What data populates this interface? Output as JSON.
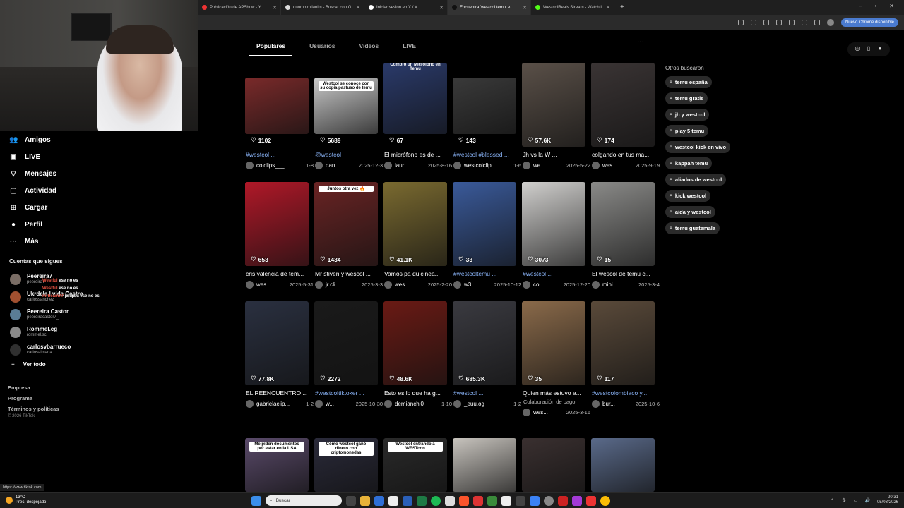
{
  "browser": {
    "tabs": [
      {
        "label": "Publicación de APShow - Y",
        "icon_color": "#e33"
      },
      {
        "label": "duomo milanim - Buscar con G",
        "icon_color": "#ddd"
      },
      {
        "label": "Iniciar sesión en X / X",
        "icon_color": "#fff"
      },
      {
        "label": "Encuentra 'westcol temu' e",
        "icon_color": "#111",
        "active": true
      },
      {
        "label": "WestcolReals Stream - Watch L",
        "icon_color": "#53fc18"
      }
    ],
    "new_tab_glyph": "+",
    "update_badge": "Nuevo Chrome disponible",
    "window_controls": [
      "–",
      "▫",
      "✕"
    ]
  },
  "sidebar": {
    "nav": [
      {
        "label": "Amigos",
        "icon": "friends-icon",
        "glyph": "👥"
      },
      {
        "label": "LIVE",
        "icon": "live-icon",
        "glyph": "▣"
      },
      {
        "label": "Mensajes",
        "icon": "messages-icon",
        "glyph": "▽"
      },
      {
        "label": "Actividad",
        "icon": "activity-icon",
        "glyph": "▢"
      },
      {
        "label": "Cargar",
        "icon": "upload-icon",
        "glyph": "⊞"
      },
      {
        "label": "Perfil",
        "icon": "profile-icon",
        "glyph": "●"
      },
      {
        "label": "Más",
        "icon": "more-icon",
        "glyph": "···"
      }
    ],
    "following_header": "Cuentas que sigues",
    "following": [
      {
        "name": "Peereira7",
        "handle": "peereira7",
        "color": "#7a6d65"
      },
      {
        "name": "Ukrdela | vida Castro",
        "handle": "carlossanchez",
        "color": "#a05030"
      },
      {
        "name": "Peereira Castor",
        "handle": "peereiracastor7_",
        "color": "#5a7d95"
      },
      {
        "name": "Rommel.cg",
        "handle": "rommel.sc",
        "color": "#8a8a8a"
      },
      {
        "name": "carlosvbarrueco",
        "handle": "carlosalmana",
        "color": "#303030"
      }
    ],
    "chat_overlay": [
      {
        "user": "Westful",
        "text": "ese no es"
      },
      {
        "user": "Westful",
        "text": "ese no es"
      },
      {
        "user": "mrbeam77",
        "text": "jajajaja ese no es"
      }
    ],
    "see_all": "Ver todo",
    "footer": [
      "Empresa",
      "Programa",
      "Términos y políticas"
    ],
    "copyright": "© 2026 TikTok",
    "status_url": "https://www.tiktok.com"
  },
  "content": {
    "tabs": [
      "Populares",
      "Usuarios",
      "Videos",
      "LIVE"
    ],
    "active_tab": "Populares",
    "more_glyph": "···",
    "videos": [
      {
        "likes": "1102",
        "desc": "#westcol ...",
        "desc_is_tag": true,
        "user": "colclips___",
        "date": "1-8",
        "thumb": "#7a2a2a"
      },
      {
        "likes": "5689",
        "desc": "@westcol",
        "desc_is_tag": true,
        "user": "dan...",
        "date": "2025-12-3",
        "thumb": "#c9c9c9",
        "caption": "Westcol se conoce con su copia pastuso de temu"
      },
      {
        "likes": "67",
        "desc": "El micrófono es de ...",
        "desc_is_tag": false,
        "user": "laur...",
        "date": "2025-8-16",
        "thumb": "#2a3a6a",
        "caption": "Compro un Micrófono en Temu"
      },
      {
        "likes": "143",
        "desc": "#westcol #blessed ...",
        "desc_is_tag": true,
        "user": "westcolclip...",
        "date": "1-6",
        "thumb": "#3a3a3a"
      },
      {
        "likes": "57.6K",
        "desc": "Jh vs la W ...",
        "desc_is_tag": false,
        "user": "we...",
        "date": "2025-5-22",
        "thumb": "#5a5048"
      },
      {
        "likes": "174",
        "desc": "colgando en tus ma...",
        "desc_is_tag": false,
        "user": "wes...",
        "date": "2025-9-19",
        "thumb": "#3a3434"
      },
      {
        "likes": "653",
        "desc": "cris valencia de tem...",
        "desc_is_tag": false,
        "user": "wes...",
        "date": "2025-5-31",
        "thumb": "#b01828"
      },
      {
        "likes": "1434",
        "desc": "Mr stiven y wescol ...",
        "desc_is_tag": false,
        "user": "jr.cli...",
        "date": "2025-3-3",
        "thumb": "#6a2424",
        "caption": "Juntos otra vez 🔥"
      },
      {
        "likes": "41.1K",
        "desc": "Vamos pa dulcinea...",
        "desc_is_tag": false,
        "user": "wes...",
        "date": "2025-2-20",
        "thumb": "#7a6a30"
      },
      {
        "likes": "33",
        "desc": "#westcoltemu ...",
        "desc_is_tag": true,
        "user": "w3...",
        "date": "2025-10-12",
        "thumb": "#3a5a9a"
      },
      {
        "likes": "3073",
        "desc": "#westcol ...",
        "desc_is_tag": true,
        "user": "col...",
        "date": "2025-12-20",
        "thumb": "#d0cfcd"
      },
      {
        "likes": "15",
        "desc": "El wescol de temu c...",
        "desc_is_tag": false,
        "user": "mini...",
        "date": "2025-3-4",
        "thumb": "#8a8a88"
      },
      {
        "likes": "77.8K",
        "desc": "EL REENCUENTRO ...",
        "desc_is_tag": false,
        "user": "gabrielaclip...",
        "date": "1-2",
        "thumb": "#2a3040"
      },
      {
        "likes": "2272",
        "desc": "#westcoltiktoker ...",
        "desc_is_tag": true,
        "user": "w...",
        "date": "2025-10-30",
        "thumb": "#1a1a1a"
      },
      {
        "likes": "48.6K",
        "desc": "Esto es lo que ha g...",
        "desc_is_tag": false,
        "user": "demianchi0",
        "date": "1-10",
        "thumb": "#6a1a14"
      },
      {
        "likes": "685.3K",
        "desc": "#westcol ...",
        "desc_is_tag": true,
        "user": "_euu.og",
        "date": "1-2",
        "thumb": "#3a3a40"
      },
      {
        "likes": "35",
        "desc": "Quien más estuvo e...",
        "desc_is_tag": false,
        "user": "wes...",
        "date": "2025-3-16",
        "thumb": "#8a6a4a",
        "sponsor": "Colaboración de pago"
      },
      {
        "likes": "117",
        "desc": "#westcolombiaco y...",
        "desc_is_tag": true,
        "user": "bur...",
        "date": "2025-10-6",
        "thumb": "#5a4a3a"
      },
      {
        "thumb": "#5a4a6a",
        "caption": "Me piden documentos por estar en la USA"
      },
      {
        "thumb": "#2a2a3a",
        "caption": "Cómo westcol ganó dinero con criptomonedas"
      },
      {
        "thumb": "#2a2a2a",
        "caption": "Westcol entrando a WESTcon"
      },
      {
        "thumb": "#c8c4be"
      },
      {
        "thumb": "#3a3030"
      },
      {
        "thumb": "#5a6a8a"
      }
    ],
    "others_header": "Otros buscaron",
    "others": [
      "temu españa",
      "temu gratis",
      "jh y westcol",
      "play 5 temu",
      "westcol kick en vivo",
      "kappah temu",
      "aliados de westcol",
      "kick westcol",
      "aida y westcol",
      "temu guatemala"
    ]
  },
  "taskbar": {
    "temp": "13°C",
    "weather": "Prec. despejado",
    "search_placeholder": "Buscar",
    "time": "20:31",
    "date": "05/03/2026"
  }
}
